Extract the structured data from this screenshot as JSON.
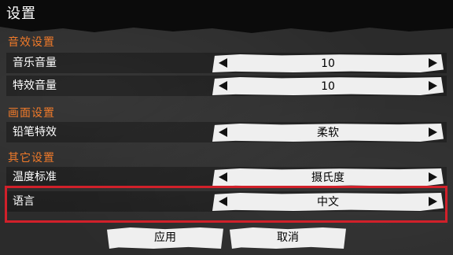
{
  "window": {
    "title": "设置"
  },
  "sections": {
    "audio": {
      "title": "音效设置"
    },
    "video": {
      "title": "画面设置"
    },
    "other": {
      "title": "其它设置"
    }
  },
  "rows": {
    "music_volume": {
      "label": "音乐音量",
      "value": "10"
    },
    "sfx_volume": {
      "label": "特效音量",
      "value": "10"
    },
    "pencil_effect": {
      "label": "铅笔特效",
      "value": "柔软"
    },
    "temperature_unit": {
      "label": "温度标准",
      "value": "摄氏度"
    },
    "language": {
      "label": "语言",
      "value": "中文"
    }
  },
  "buttons": {
    "apply": "应用",
    "cancel": "取消"
  },
  "colors": {
    "section_title": "#f07a2a",
    "highlight_border": "#d1202a",
    "stepper_bg": "#efefef"
  }
}
